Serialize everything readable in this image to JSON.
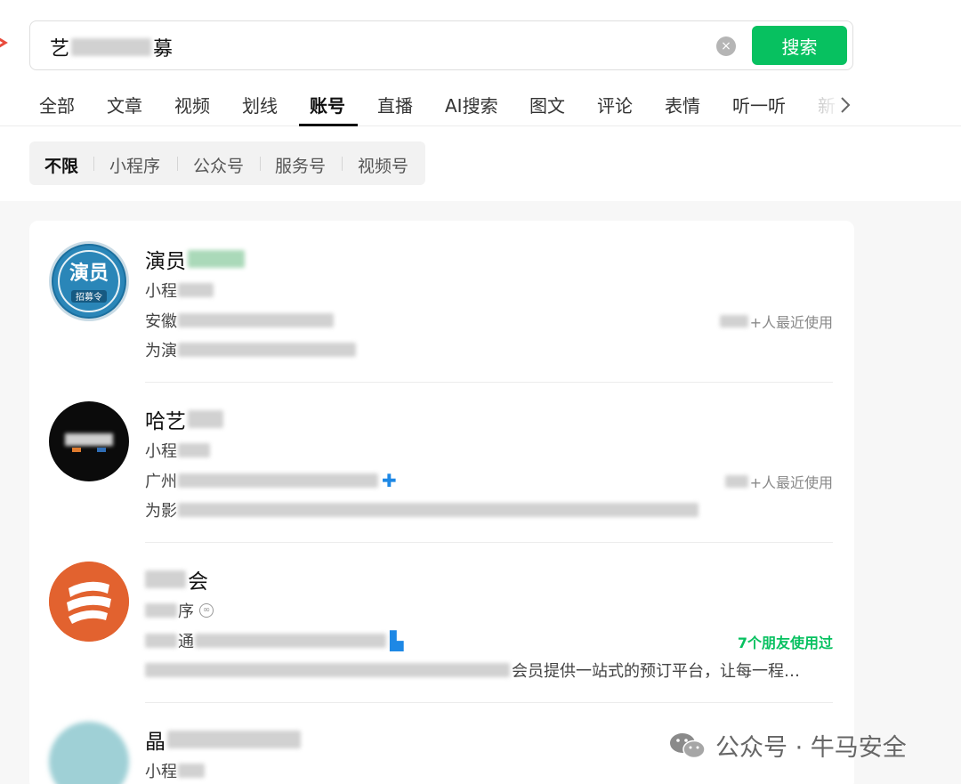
{
  "search": {
    "query_prefix": "艺",
    "query_suffix": "募",
    "clear_icon": "×",
    "button_label": "搜索"
  },
  "tabs": [
    {
      "label": "全部"
    },
    {
      "label": "文章"
    },
    {
      "label": "视频"
    },
    {
      "label": "划线"
    },
    {
      "label": "账号",
      "active": true
    },
    {
      "label": "直播"
    },
    {
      "label": "AI搜索"
    },
    {
      "label": "图文"
    },
    {
      "label": "评论"
    },
    {
      "label": "表情"
    },
    {
      "label": "听一听"
    },
    {
      "label": "新"
    }
  ],
  "tab_more_icon": "chevron-right-icon",
  "filters": [
    {
      "label": "不限",
      "active": true
    },
    {
      "label": "小程序"
    },
    {
      "label": "公众号"
    },
    {
      "label": "服务号"
    },
    {
      "label": "视频号"
    }
  ],
  "results": [
    {
      "name": "演员",
      "type": "小程",
      "location": "安徽",
      "description": "为演",
      "usage": "+人最近使用",
      "avatar_text": "演员",
      "avatar_sub": "招募令"
    },
    {
      "name": "哈艺",
      "type": "小程",
      "location": "广州",
      "description": "为影",
      "usage": "+人最近使用"
    },
    {
      "name": "会",
      "type": "序",
      "location": "通",
      "description": "会员提供一站式的预订平台，让每一程…",
      "usage": "7个朋友使用过"
    },
    {
      "name": "晶",
      "type": "小程"
    }
  ],
  "watermark": {
    "text": "公众号 · 牛马安全",
    "icon": "wechat-icon"
  },
  "colors": {
    "accent_green": "#07c160",
    "badge_blue": "#1e88e5",
    "avatar_orange": "#e2622f"
  }
}
